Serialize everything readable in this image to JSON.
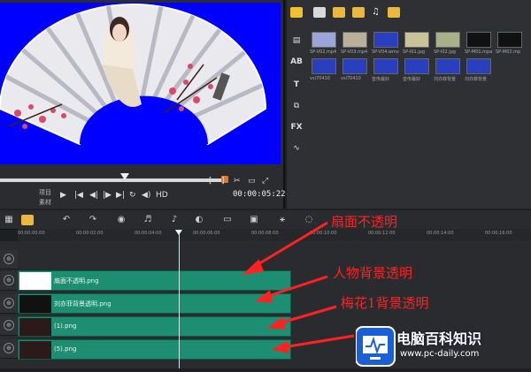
{
  "preview": {
    "project_label": "项目",
    "clip_label": "素材",
    "hd_label": "HD",
    "timecode": "00:00:05:22",
    "bracket_left": "[",
    "bracket_right": "]"
  },
  "library": {
    "thumbs": [
      {
        "caption": "SP-V02.mp4",
        "color": "#9aa6d8"
      },
      {
        "caption": "SP-V03.mp4",
        "color": "#b8b09a"
      },
      {
        "caption": "SP-V04.wmv",
        "color": "#2a3fbf"
      },
      {
        "caption": "SP-I01.jpg",
        "color": "#c9c39a"
      },
      {
        "caption": "SP-I02.jpg",
        "color": "#a8b08a"
      },
      {
        "caption": "SP-M01.mpa",
        "color": "#111111"
      },
      {
        "caption": "SP-M02.mp",
        "color": "#111111"
      },
      {
        "caption": "vsi70410",
        "color": "#2a3fbf"
      },
      {
        "caption": "vsi70410",
        "color": "#2a3fbf"
      },
      {
        "caption": "音传最好",
        "color": "#2a3fbf"
      },
      {
        "caption": "音传最好",
        "color": "#2a3fbf"
      },
      {
        "caption": "刘亦菲背景",
        "color": "#2a3fbf"
      },
      {
        "caption": "刘亦菲背景",
        "color": "#2a3fbf"
      }
    ]
  },
  "ruler": {
    "ticks": [
      "00:00:00:00",
      "00:00:02:00",
      "00:00:04:00",
      "00:00:06:00",
      "00:00:08:00",
      "00:00:10:00",
      "00:00:12:00",
      "00:00:14:00",
      "00:00:16:00"
    ]
  },
  "tracks": [
    {
      "name": "扇面不透明.png"
    },
    {
      "name": "刘亦菲背景透明.png"
    },
    {
      "name": "(1).png"
    },
    {
      "name": "(5).png"
    }
  ],
  "annotations": {
    "a1": "扇面不透明",
    "a2": "人物背景透明",
    "a3": "梅花1背景透明"
  },
  "watermark": {
    "title": "电脑百科知识",
    "url": "www.pc-daily.com"
  },
  "colors": {
    "preview_bg": "#0000ff",
    "clip": "#1e8e72",
    "annotation": "#ff2222"
  }
}
